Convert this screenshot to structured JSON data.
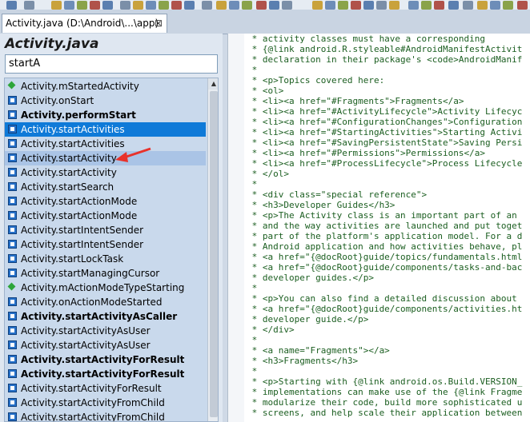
{
  "tab": {
    "title": "Activity.java (D:\\Android\\...\\app)",
    "close": "⊠"
  },
  "panel": {
    "title": "Activity.java"
  },
  "search": {
    "value": "startA"
  },
  "list": [
    {
      "label": "Activity.mStartedActivity",
      "icon": "field-icon",
      "bold": false
    },
    {
      "label": "Activity.onStart",
      "icon": "method-icon",
      "bold": false
    },
    {
      "label": "Activity.performStart",
      "icon": "method-icon",
      "bold": true
    },
    {
      "label": "Activity.startActivities",
      "icon": "method-icon",
      "bold": false,
      "selected": true
    },
    {
      "label": "Activity.startActivities",
      "icon": "method-icon",
      "bold": false
    },
    {
      "label": "Activity.startActivity",
      "icon": "method-icon",
      "bold": false,
      "hover": true
    },
    {
      "label": "Activity.startActivity",
      "icon": "method-icon",
      "bold": false
    },
    {
      "label": "Activity.startSearch",
      "icon": "method-icon",
      "bold": false
    },
    {
      "label": "Activity.startActionMode",
      "icon": "method-icon",
      "bold": false
    },
    {
      "label": "Activity.startActionMode",
      "icon": "method-icon",
      "bold": false
    },
    {
      "label": "Activity.startIntentSender",
      "icon": "method-icon",
      "bold": false
    },
    {
      "label": "Activity.startIntentSender",
      "icon": "method-icon",
      "bold": false
    },
    {
      "label": "Activity.startLockTask",
      "icon": "method-icon",
      "bold": false
    },
    {
      "label": "Activity.startManagingCursor",
      "icon": "method-icon",
      "bold": false
    },
    {
      "label": "Activity.mActionModeTypeStarting",
      "icon": "field-icon",
      "bold": false
    },
    {
      "label": "Activity.onActionModeStarted",
      "icon": "method-icon",
      "bold": false
    },
    {
      "label": "Activity.startActivityAsCaller",
      "icon": "method-icon",
      "bold": true
    },
    {
      "label": "Activity.startActivityAsUser",
      "icon": "method-icon",
      "bold": false
    },
    {
      "label": "Activity.startActivityAsUser",
      "icon": "method-icon",
      "bold": false
    },
    {
      "label": "Activity.startActivityForResult",
      "icon": "method-icon",
      "bold": true
    },
    {
      "label": "Activity.startActivityForResult",
      "icon": "method-icon",
      "bold": true
    },
    {
      "label": "Activity.startActivityForResult",
      "icon": "method-icon",
      "bold": false
    },
    {
      "label": "Activity.startActivityFromChild",
      "icon": "method-icon",
      "bold": false
    },
    {
      "label": "Activity.startActivityFromChild",
      "icon": "method-icon",
      "bold": false
    }
  ],
  "code": [
    " * activity classes must have a corresponding",
    " * {@link android.R.styleable#AndroidManifestActivit",
    " * declaration in their package's <code>AndroidManif",
    " *",
    " * <p>Topics covered here:",
    " * <ol>",
    " * <li><a href=\"#Fragments\">Fragments</a>",
    " * <li><a href=\"#ActivityLifecycle\">Activity Lifecyc",
    " * <li><a href=\"#ConfigurationChanges\">Configuration",
    " * <li><a href=\"#StartingActivities\">Starting Activi",
    " * <li><a href=\"#SavingPersistentState\">Saving Persi",
    " * <li><a href=\"#Permissions\">Permissions</a>",
    " * <li><a href=\"#ProcessLifecycle\">Process Lifecycle",
    " * </ol>",
    " *",
    " * <div class=\"special reference\">",
    " * <h3>Developer Guides</h3>",
    " * <p>The Activity class is an important part of an",
    " * and the way activities are launched and put toget",
    " * part of the platform's application model. For a d",
    " * Android application and how activities behave, pl",
    " * <a href=\"{@docRoot}guide/topics/fundamentals.html",
    " * <a href=\"{@docRoot}guide/components/tasks-and-bac",
    " * developer guides.</p>",
    " *",
    " * <p>You can also find a detailed discussion about",
    " * <a href=\"{@docRoot}guide/components/activities.ht",
    " * developer guide.</p>",
    " * </div>",
    " *",
    " * <a name=\"Fragments\"></a>",
    " * <h3>Fragments</h3>",
    " *",
    " * <p>Starting with {@link android.os.Build.VERSION_",
    " * implementations can make use of the {@link Fragme",
    " * modularize their code, build more sophisticated u",
    " * screens, and help scale their application between"
  ],
  "colors": {
    "selection": "#0f7ad8",
    "hover": "#aac4e6",
    "list_bg": "#c9d9ec",
    "code_text": "#1b5e20",
    "arrow": "#e8322b"
  }
}
